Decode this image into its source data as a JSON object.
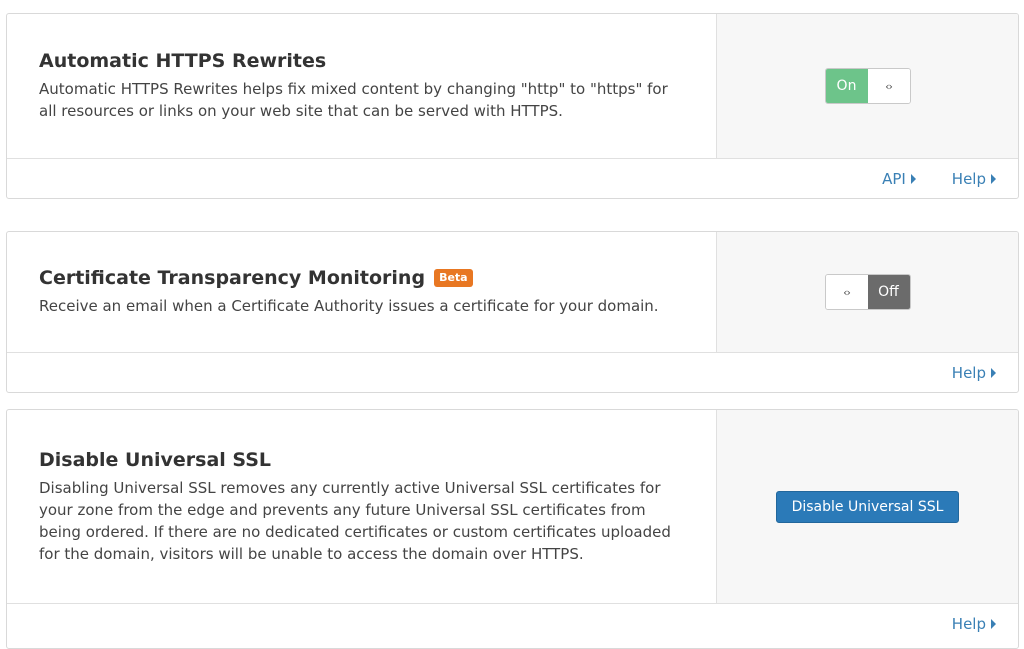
{
  "cards": [
    {
      "title": "Automatic HTTPS Rewrites",
      "description": "Automatic HTTPS Rewrites helps fix mixed content by changing \"http\" to \"https\" for all resources or links on your web site that can be served with HTTPS.",
      "toggle": {
        "state": "On",
        "handle": "‹›"
      },
      "links": {
        "api": "API",
        "help": "Help"
      }
    },
    {
      "title": "Certificate Transparency Monitoring",
      "badge": "Beta",
      "description": "Receive an email when a Certificate Authority issues a certificate for your domain.",
      "toggle": {
        "state": "Off",
        "handle": "‹›"
      },
      "links": {
        "help": "Help"
      }
    },
    {
      "title": "Disable Universal SSL",
      "description": "Disabling Universal SSL removes any currently active Universal SSL certificates for your zone from the edge and prevents any future Universal SSL certificates from being ordered. If there are no dedicated certificates or custom certificates uploaded for the domain, visitors will be unable to access the domain over HTTPS.",
      "button": "Disable Universal SSL",
      "links": {
        "help": "Help"
      }
    }
  ],
  "colors": {
    "toggle_on": "#6dc48a",
    "toggle_off": "#6b6b6b",
    "badge": "#e87722",
    "link": "#3a80b5",
    "primary_button": "#2b7ab8"
  },
  "icons": {
    "link_arrow": "caret-right-icon",
    "toggle_handle": "arrows-left-right-icon"
  }
}
